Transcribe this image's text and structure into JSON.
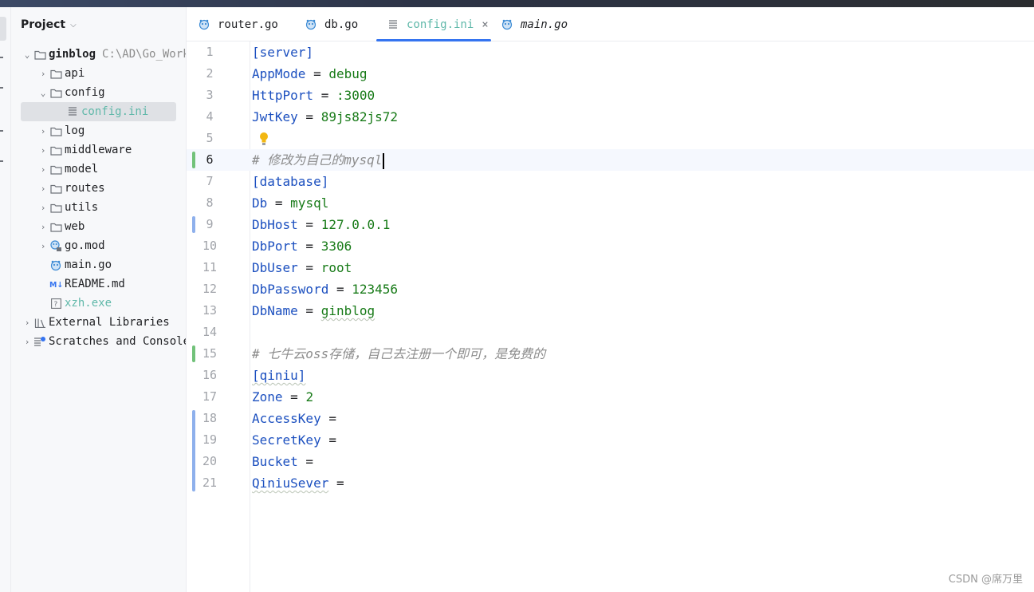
{
  "project_panel": {
    "title": "Project",
    "tree": [
      {
        "label": "ginblog",
        "path": "C:\\AD\\Go_Work",
        "icon": "folder-icon",
        "expanded": true
      },
      {
        "label": "api",
        "icon": "folder-icon"
      },
      {
        "label": "config",
        "icon": "folder-icon",
        "expanded": true
      },
      {
        "label": "config.ini",
        "icon": "ini-file-icon",
        "selected": true
      },
      {
        "label": "log",
        "icon": "folder-icon"
      },
      {
        "label": "middleware",
        "icon": "folder-icon"
      },
      {
        "label": "model",
        "icon": "folder-icon"
      },
      {
        "label": "routes",
        "icon": "folder-icon"
      },
      {
        "label": "utils",
        "icon": "folder-icon"
      },
      {
        "label": "web",
        "icon": "folder-icon"
      },
      {
        "label": "go.mod",
        "icon": "go-module-icon"
      },
      {
        "label": "main.go",
        "icon": "go-file-icon"
      },
      {
        "label": "README.md",
        "icon": "markdown-icon"
      },
      {
        "label": "xzh.exe",
        "icon": "unknown-file-icon"
      },
      {
        "label": "External Libraries",
        "icon": "library-icon"
      },
      {
        "label": "Scratches and Consoles",
        "icon": "scratches-icon"
      }
    ]
  },
  "tabs": [
    {
      "label": "router.go",
      "icon": "go-file-icon"
    },
    {
      "label": "db.go",
      "icon": "go-file-icon"
    },
    {
      "label": "config.ini",
      "icon": "ini-file-icon",
      "active": true,
      "close": "×"
    },
    {
      "label": "main.go",
      "icon": "go-file-icon"
    }
  ],
  "editor": {
    "current_line": 6,
    "lines": [
      {
        "n": "1",
        "parts": {
          "section": "[server]"
        }
      },
      {
        "n": "2",
        "parts": {
          "key": "AppMode",
          "eq": " = ",
          "value": "debug"
        }
      },
      {
        "n": "3",
        "parts": {
          "key": "HttpPort",
          "eq": " = ",
          "value": ":3000"
        }
      },
      {
        "n": "4",
        "parts": {
          "key": "JwtKey",
          "eq": " = ",
          "value": "89js82js72"
        }
      },
      {
        "n": "5",
        "parts": {}
      },
      {
        "n": "6",
        "parts": {
          "comment": "# 修改为自己的mysql"
        }
      },
      {
        "n": "7",
        "parts": {
          "section": "[database]"
        }
      },
      {
        "n": "8",
        "parts": {
          "key": "Db",
          "eq": " = ",
          "value": "mysql"
        }
      },
      {
        "n": "9",
        "parts": {
          "key": "DbHost",
          "eq": " = ",
          "value": "127.0.0.1"
        }
      },
      {
        "n": "10",
        "parts": {
          "key": "DbPort",
          "eq": " = ",
          "value": "3306"
        }
      },
      {
        "n": "11",
        "parts": {
          "key": "DbUser",
          "eq": " = ",
          "value": "root"
        }
      },
      {
        "n": "12",
        "parts": {
          "key": "DbPassword",
          "eq": " = ",
          "value": "123456"
        }
      },
      {
        "n": "13",
        "parts": {
          "key": "DbName",
          "eq": " = ",
          "value": "ginblog"
        }
      },
      {
        "n": "14",
        "parts": {}
      },
      {
        "n": "15",
        "parts": {
          "comment": "# 七牛云oss存储，自己去注册一个即可，是免费的"
        }
      },
      {
        "n": "16",
        "parts": {
          "section": "[qiniu]"
        }
      },
      {
        "n": "17",
        "parts": {
          "key": "Zone",
          "eq": " = ",
          "value": "2"
        }
      },
      {
        "n": "18",
        "parts": {
          "key": "AccessKey",
          "eq": " =",
          "value": ""
        }
      },
      {
        "n": "19",
        "parts": {
          "key": "SecretKey",
          "eq": " =",
          "value": ""
        }
      },
      {
        "n": "20",
        "parts": {
          "key": "Bucket",
          "eq": " =",
          "value": ""
        }
      },
      {
        "n": "21",
        "parts": {
          "key": "QiniuSever",
          "eq": " =",
          "value": ""
        }
      }
    ]
  },
  "watermark": "CSDN @席万里",
  "colors": {
    "accent": "#3574f0",
    "added_marker": "#72c27a",
    "modified_marker": "#8eb0ec",
    "key": "#1b4fbf",
    "value": "#177a17"
  }
}
